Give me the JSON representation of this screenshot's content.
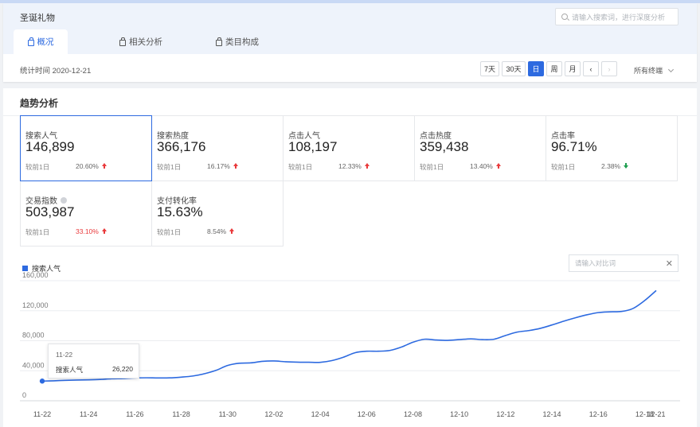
{
  "header": {
    "title": "圣诞礼物",
    "search_placeholder": "请输入搜索词，进行深度分析",
    "tabs": [
      {
        "label": "概况",
        "active": true
      },
      {
        "label": "相关分析",
        "active": false
      },
      {
        "label": "类目构成",
        "active": false
      }
    ]
  },
  "toolbar": {
    "stat_time": "统计时间 2020-12-21",
    "ranges": [
      "7天",
      "30天",
      "日",
      "周",
      "月"
    ],
    "active_range": "日",
    "prev_icon": "chevron-left-icon",
    "next_icon": "chevron-right-icon",
    "terminal": "所有终端"
  },
  "trend": {
    "title": "趋势分析",
    "compare_label": "较前1日",
    "cards": [
      {
        "label": "搜索人气",
        "value": "146,899",
        "pct": "20.60%",
        "dir": "up",
        "pct_color": "normal",
        "active": true
      },
      {
        "label": "搜索热度",
        "value": "366,176",
        "pct": "16.17%",
        "dir": "up",
        "pct_color": "normal"
      },
      {
        "label": "点击人气",
        "value": "108,197",
        "pct": "12.33%",
        "dir": "up",
        "pct_color": "normal"
      },
      {
        "label": "点击热度",
        "value": "359,438",
        "pct": "13.40%",
        "dir": "up",
        "pct_color": "normal"
      },
      {
        "label": "点击率",
        "value": "96.71%",
        "pct": "2.38%",
        "dir": "down",
        "pct_color": "normal"
      },
      {
        "label": "交易指数",
        "value": "503,987",
        "pct": "33.10%",
        "dir": "up",
        "pct_color": "red",
        "info": true
      },
      {
        "label": "支付转化率",
        "value": "15.63%",
        "pct": "8.54%",
        "dir": "up",
        "pct_color": "normal"
      }
    ],
    "compare_placeholder": "请输入对比词"
  },
  "chart_data": {
    "type": "line",
    "series": [
      {
        "name": "搜索人气",
        "values": [
          26220,
          26600,
          27200,
          27600,
          27900,
          28400,
          29300,
          29600,
          30400,
          30600,
          30400,
          30500,
          31500,
          33000,
          36000,
          40500,
          47000,
          50000,
          50500,
          52500,
          53000,
          52000,
          51500,
          51300,
          51200,
          53500,
          58000,
          64000,
          66000,
          66000,
          67000,
          71500,
          78000,
          82000,
          81000,
          80500,
          81500,
          82500,
          81500,
          82000,
          87000,
          91500,
          93500,
          96500,
          101000,
          106000,
          110500,
          114500,
          117500,
          118500,
          119000,
          123000,
          133500,
          146899
        ]
      }
    ],
    "color": "#2d6ae0",
    "x_tick_labels": [
      "11-22",
      "11-24",
      "11-26",
      "11-28",
      "11-30",
      "12-02",
      "12-04",
      "12-06",
      "12-08",
      "12-10",
      "12-12",
      "12-14",
      "12-16",
      "12-18",
      "12-21"
    ],
    "y_tick_labels": [
      "0",
      "40,000",
      "80,000",
      "120,000",
      "160,000"
    ],
    "ylim": [
      0,
      160000
    ],
    "grid": true,
    "legend": "top-left",
    "tooltip": {
      "date": "11-22",
      "name": "搜索人气",
      "value": "26,220"
    }
  }
}
